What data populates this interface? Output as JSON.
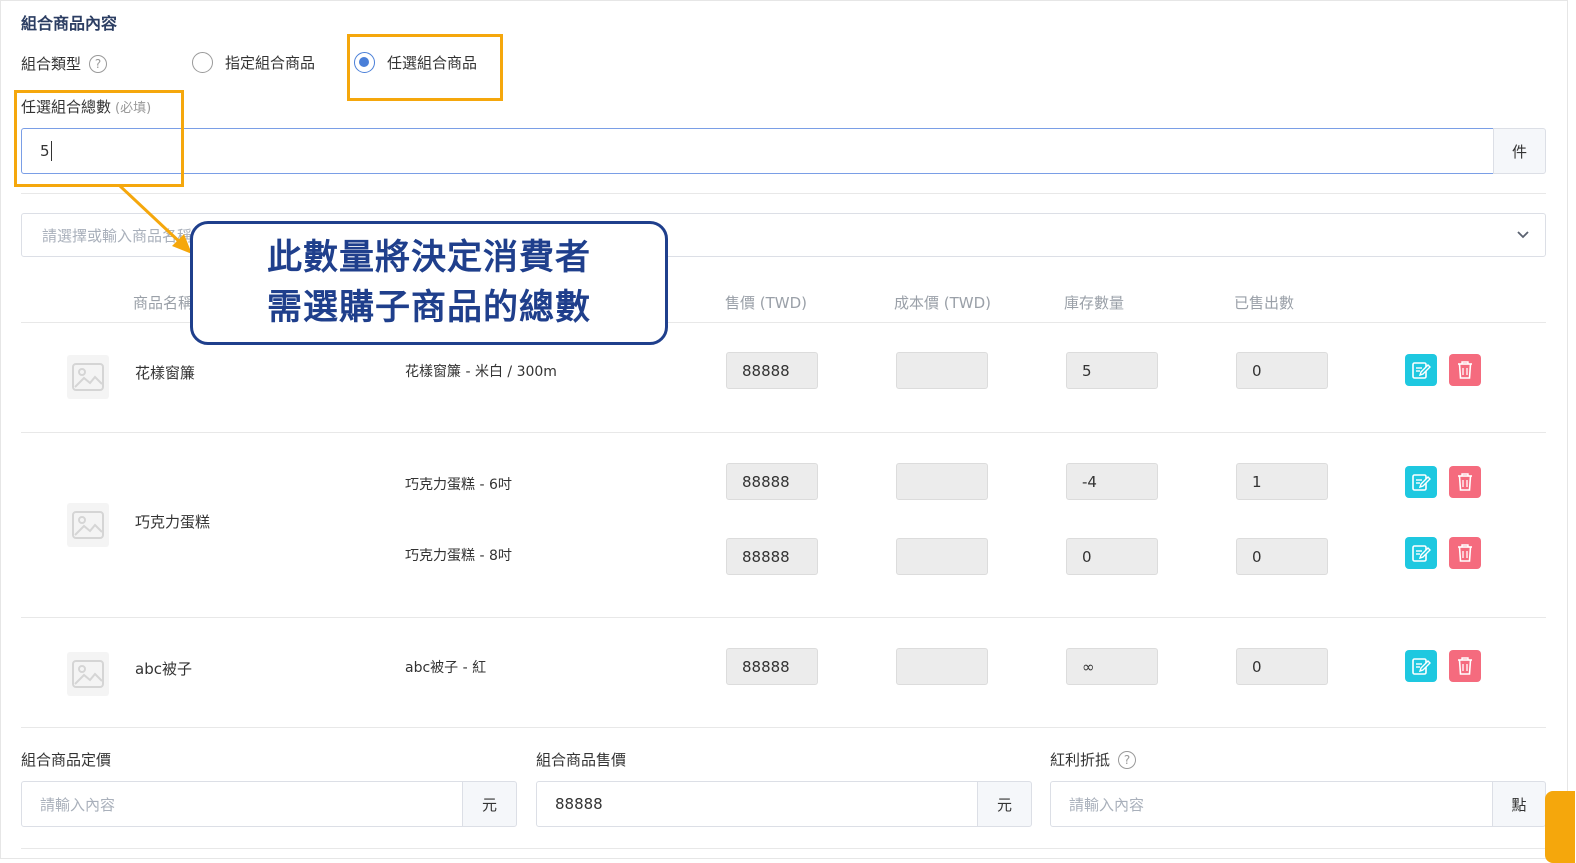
{
  "section_title": "組合商品內容",
  "combo_type": {
    "label": "組合類型",
    "help_icon": "question-circle-icon",
    "options": [
      {
        "label": "指定組合商品",
        "checked": false
      },
      {
        "label": "任選組合商品",
        "checked": true
      }
    ]
  },
  "total_count": {
    "label": "任選組合總數",
    "required": "(必填)",
    "value": "5",
    "unit": "件"
  },
  "product_select": {
    "placeholder": "請選擇或輸入商品名稱"
  },
  "table": {
    "headers": [
      "商品名稱",
      "售價 (TWD)",
      "成本價 (TWD)",
      "庫存數量",
      "已售出數"
    ],
    "products": [
      {
        "name": "花樣窗簾",
        "variants": [
          {
            "spec": "花樣窗簾 - 米白 / 300m",
            "price": "88888",
            "cost": "",
            "stock": "5",
            "sold": "0"
          }
        ]
      },
      {
        "name": "巧克力蛋糕",
        "variants": [
          {
            "spec": "巧克力蛋糕 - 6吋",
            "price": "88888",
            "cost": "",
            "stock": "-4",
            "sold": "1"
          },
          {
            "spec": "巧克力蛋糕 - 8吋",
            "price": "88888",
            "cost": "",
            "stock": "0",
            "sold": "0"
          }
        ]
      },
      {
        "name": "abc被子",
        "variants": [
          {
            "spec": "abc被子 - 紅",
            "price": "88888",
            "cost": "",
            "stock": "∞",
            "sold": "0"
          }
        ]
      }
    ]
  },
  "bottom": {
    "list_price": {
      "label": "組合商品定價",
      "placeholder": "請輸入內容",
      "value": "",
      "unit": "元"
    },
    "sale_price": {
      "label": "組合商品售價",
      "placeholder": "",
      "value": "88888",
      "unit": "元"
    },
    "bonus": {
      "label": "紅利折抵",
      "placeholder": "請輸入內容",
      "value": "",
      "unit": "點"
    }
  },
  "callout": {
    "line1": "此數量將決定消費者",
    "line2": "需選購子商品的總數"
  },
  "colors": {
    "highlight": "#f5a70c",
    "callout": "#1f3f8c",
    "radio_active": "#4a7fd8",
    "edit_button": "#1ec8e0",
    "delete_button": "#f56b7e"
  }
}
